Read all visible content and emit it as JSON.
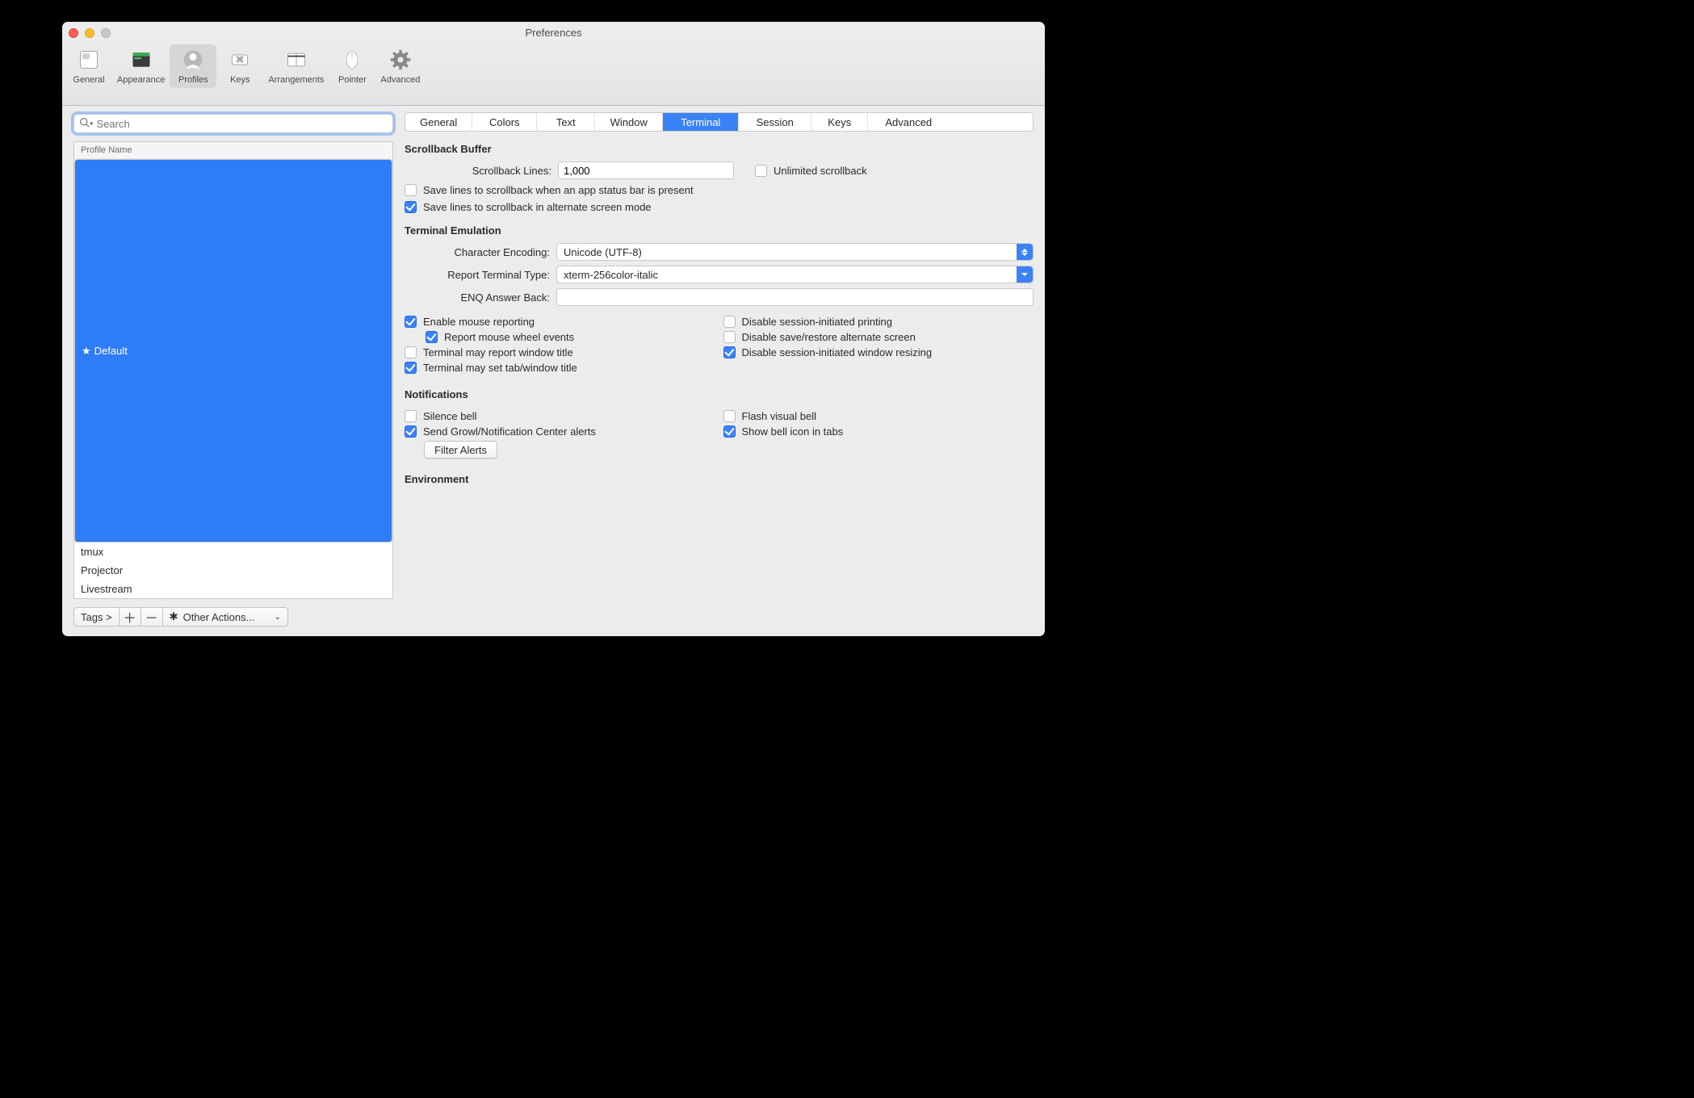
{
  "window": {
    "title": "Preferences"
  },
  "toolbar": {
    "items": [
      {
        "label": "General"
      },
      {
        "label": "Appearance"
      },
      {
        "label": "Profiles"
      },
      {
        "label": "Keys"
      },
      {
        "label": "Arrangements"
      },
      {
        "label": "Pointer"
      },
      {
        "label": "Advanced"
      }
    ]
  },
  "sidebar": {
    "search_placeholder": "Search",
    "header": "Profile Name",
    "profiles": [
      {
        "name": "Default",
        "starred": true
      },
      {
        "name": "tmux",
        "starred": false
      },
      {
        "name": "Projector",
        "starred": false
      },
      {
        "name": "Livestream",
        "starred": false
      }
    ],
    "bottom": {
      "tags": "Tags >",
      "other_actions": "Other Actions..."
    }
  },
  "subtabs": [
    "General",
    "Colors",
    "Text",
    "Window",
    "Terminal",
    "Session",
    "Keys",
    "Advanced"
  ],
  "sections": {
    "scrollback": {
      "title": "Scrollback Buffer",
      "lines_label": "Scrollback Lines:",
      "lines_value": "1,000",
      "unlimited_label": "Unlimited scrollback",
      "save_statusbar": "Save lines to scrollback when an app status bar is present",
      "save_altscreen": "Save lines to scrollback in alternate screen mode"
    },
    "te": {
      "title": "Terminal Emulation",
      "enc_label": "Character Encoding:",
      "enc_value": "Unicode (UTF-8)",
      "tt_label": "Report Terminal Type:",
      "tt_value": "xterm-256color-italic",
      "enq_label": "ENQ Answer Back:",
      "enq_value": "",
      "l1": "Enable mouse reporting",
      "l1a": "Report mouse wheel events",
      "l2": "Terminal may report window title",
      "l3": "Terminal may set tab/window title",
      "r1": "Disable session-initiated printing",
      "r2": "Disable save/restore alternate screen",
      "r3": "Disable session-initiated window resizing"
    },
    "notif": {
      "title": "Notifications",
      "l1": "Silence bell",
      "l2": "Send Growl/Notification Center alerts",
      "r1": "Flash visual bell",
      "r2": "Show bell icon in tabs",
      "filter": "Filter Alerts"
    },
    "env": {
      "title": "Environment"
    }
  }
}
